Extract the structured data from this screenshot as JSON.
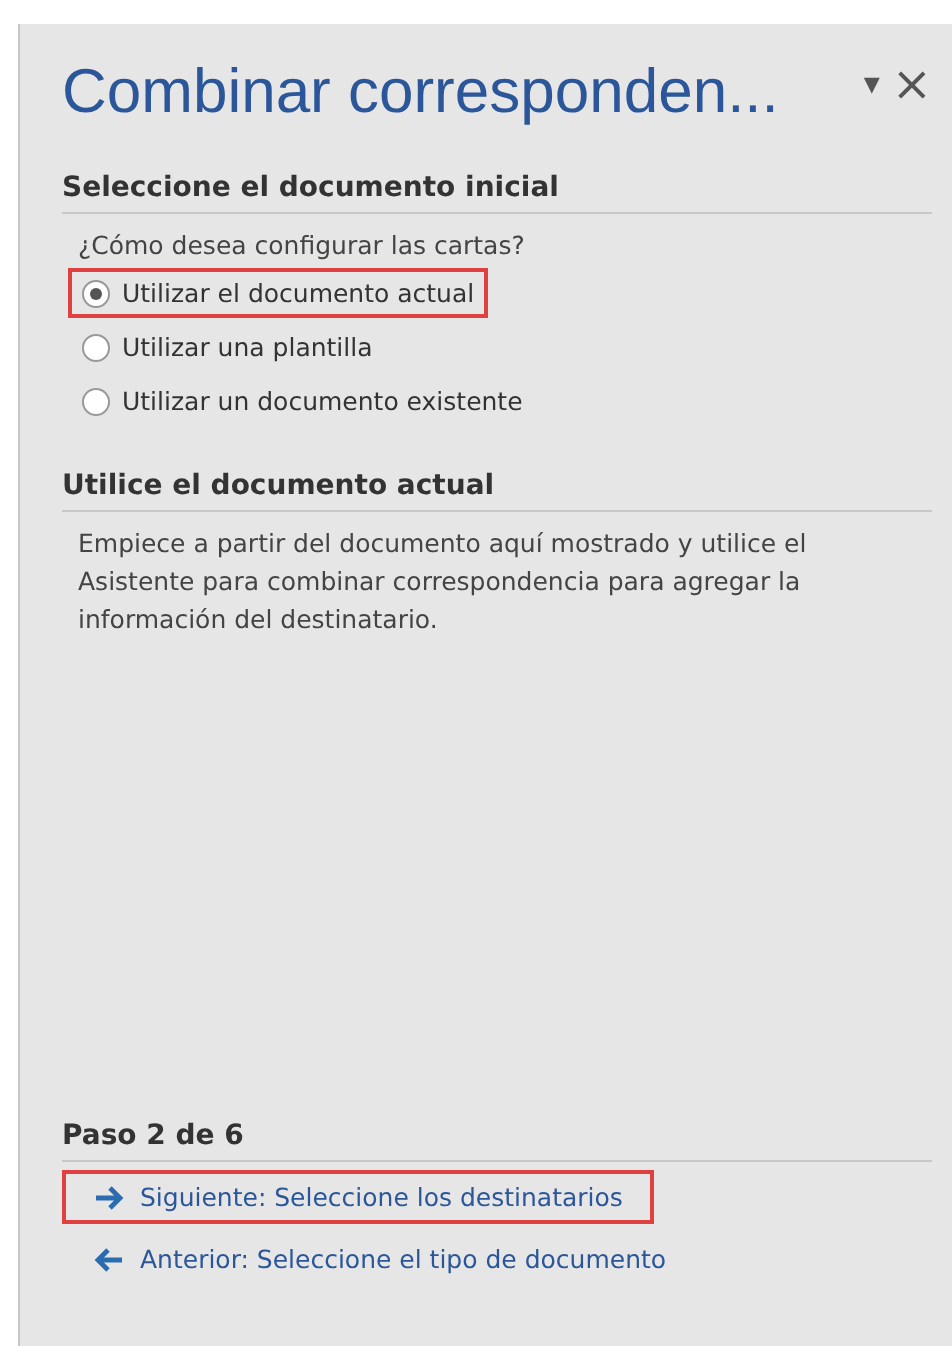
{
  "pane": {
    "title": "Combinar corresponden...",
    "menu_glyph": "▾",
    "close_glyph": "×"
  },
  "sections": [
    {
      "heading": "Seleccione el documento inicial",
      "question": "¿Cómo desea configurar las cartas?",
      "options": [
        {
          "label": "Utilizar el documento actual",
          "selected": true,
          "highlighted": true
        },
        {
          "label": "Utilizar una plantilla",
          "selected": false,
          "highlighted": false
        },
        {
          "label": "Utilizar un documento existente",
          "selected": false,
          "highlighted": false
        }
      ]
    },
    {
      "heading": "Utilice el documento actual",
      "description": "Empiece a partir del documento aquí mostrado y utilice el Asistente para combinar correspondencia para agregar la información del destinatario."
    }
  ],
  "step": {
    "heading": "Paso 2 de 6",
    "links": [
      {
        "kind": "next",
        "label": "Siguiente: Seleccione los destinatarios",
        "highlighted": true
      },
      {
        "kind": "back",
        "label": "Anterior: Seleccione el tipo de documento",
        "highlighted": false
      }
    ]
  }
}
